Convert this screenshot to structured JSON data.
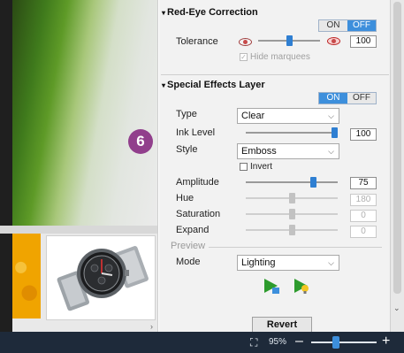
{
  "redeye": {
    "title": "Red-Eye Correction",
    "on_label": "ON",
    "off_label": "OFF",
    "active": "OFF",
    "tolerance_label": "Tolerance",
    "tolerance_value": "100",
    "tolerance_level": 0.5,
    "hide_marquees_label": "Hide marquees",
    "hide_marquees_checked": true
  },
  "special": {
    "title": "Special Effects Layer",
    "on_label": "ON",
    "off_label": "OFF",
    "active": "ON",
    "type_label": "Type",
    "type_value": "Clear",
    "ink_label": "Ink Level",
    "ink_value": "100",
    "ink_level": 1.0,
    "style_label": "Style",
    "style_value": "Emboss",
    "invert_label": "Invert",
    "invert_checked": false,
    "amplitude_label": "Amplitude",
    "amplitude_value": "75",
    "amplitude_level": 0.75,
    "hue_label": "Hue",
    "hue_value": "180",
    "hue_level": 0.5,
    "saturation_label": "Saturation",
    "saturation_value": "0",
    "saturation_level": 0.5,
    "expand_label": "Expand",
    "expand_value": "0",
    "expand_level": 0.5,
    "preview_label": "Preview",
    "mode_label": "Mode",
    "mode_value": "Lighting"
  },
  "badge": "6",
  "revert_label": "Revert",
  "status": {
    "zoom_text": "95%",
    "zoom_level": 0.35,
    "minus": "–",
    "plus": "+"
  },
  "colors": {
    "accent": "#3d8fdc",
    "badge": "#913f8c",
    "statusbar": "#1e2a3a"
  },
  "icons": {
    "fit": "fit-screen-icon",
    "apply": "apply-green-icon",
    "light": "light-bulb-icon"
  }
}
